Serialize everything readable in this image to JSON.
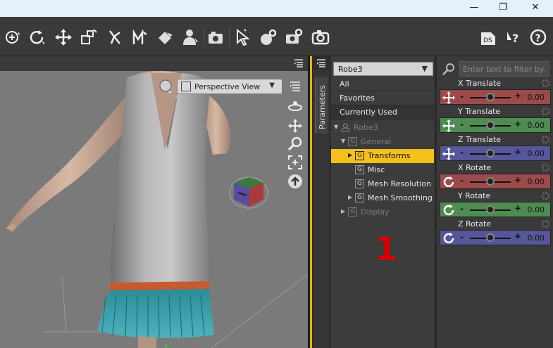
{
  "window": {
    "minimize": "—",
    "maximize": "❐",
    "close": "✕"
  },
  "toolbar": {
    "tools": [
      "universal-tool-icon",
      "rotate-tool-icon",
      "translate-tool-icon",
      "scale-tool-icon",
      "joint-editor-icon",
      "morph-tool-icon",
      "surface-selection-icon",
      "figure-shape-icon",
      "camera-icon",
      "node-selection-icon",
      "render-settings-icon",
      "render-icon",
      "render-camera-icon"
    ],
    "right_tools": [
      "daz-studio-icon",
      "help-whats-this-icon",
      "help-icon"
    ],
    "ds_label": "DS"
  },
  "viewport": {
    "view_label": "Perspective View",
    "controls": [
      "orbit-icon",
      "pan-icon",
      "zoom-icon",
      "frame-icon",
      "reset-view-icon"
    ]
  },
  "side_tab": {
    "label": "Parameters"
  },
  "tree": {
    "node_select": "Robe3",
    "filters": [
      "All",
      "Favorites",
      "Currently Used"
    ],
    "nodes": [
      {
        "label": "Robe3",
        "level": 0,
        "expanded": true,
        "disabled": true,
        "selected": false
      },
      {
        "label": "General",
        "level": 1,
        "expanded": true,
        "disabled": true,
        "selected": false
      },
      {
        "label": "Transforms",
        "level": 2,
        "expanded": false,
        "disabled": false,
        "selected": true
      },
      {
        "label": "Misc",
        "level": 2,
        "expanded": null,
        "disabled": false,
        "selected": false
      },
      {
        "label": "Mesh Resolution",
        "level": 2,
        "expanded": null,
        "disabled": false,
        "selected": false
      },
      {
        "label": "Mesh Smoothing",
        "level": 2,
        "expanded": false,
        "disabled": false,
        "selected": false
      },
      {
        "label": "Display",
        "level": 1,
        "expanded": false,
        "disabled": true,
        "selected": false
      }
    ],
    "annotation": "1"
  },
  "params": {
    "filter_placeholder": "Enter text to filter by...",
    "items": [
      {
        "name": "X Translate",
        "value": "0.00",
        "kind": "translate",
        "color": "#9c4b4b",
        "slider": 0.5
      },
      {
        "name": "Y Translate",
        "value": "0.00",
        "kind": "translate",
        "color": "#4f8c52",
        "slider": 0.5
      },
      {
        "name": "Z Translate",
        "value": "0.00",
        "kind": "translate",
        "color": "#55579a",
        "slider": 0.5
      },
      {
        "name": "X Rotate",
        "value": "0.00",
        "kind": "rotate",
        "color": "#9c4b4b",
        "slider": 0.5
      },
      {
        "name": "Y Rotate",
        "value": "0.00",
        "kind": "rotate",
        "color": "#4f8c52",
        "slider": 0.5
      },
      {
        "name": "Z Rotate",
        "value": "0.00",
        "kind": "rotate",
        "color": "#55579a",
        "slider": 0.5
      }
    ]
  },
  "colors": {
    "accent": "#f4c01c",
    "annotation": "#d40000"
  }
}
